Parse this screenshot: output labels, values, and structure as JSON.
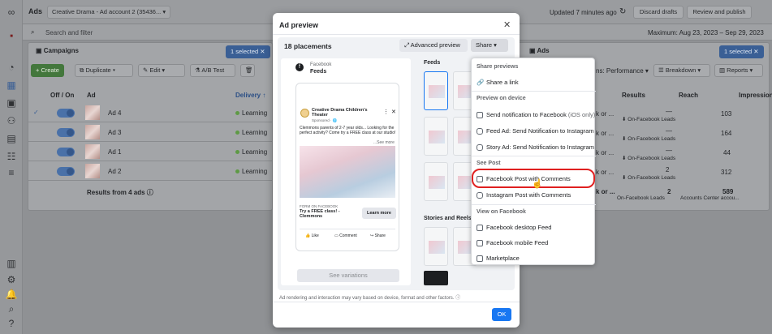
{
  "topbar": {
    "app": "Ads",
    "account": "Creative Drama - Ad account 2 (35436...",
    "updated": "Updated 7 minutes ago",
    "discard": "Discard drafts",
    "review": "Review and publish"
  },
  "searchbar": {
    "placeholder": "Search and filter",
    "date_range": "Maximum: Aug 23, 2023 – Sep 29, 2023"
  },
  "campaigns": {
    "tab": "Campaigns",
    "selected": "1 selected",
    "create": "+ Create",
    "duplicate": "Duplicate",
    "edit": "Edit",
    "abtest": "A/B Test"
  },
  "ads_tab": {
    "tab": "Ads",
    "selected": "1 selected",
    "columns": "ns: Performance",
    "breakdown": "Breakdown",
    "reports": "Reports"
  },
  "table": {
    "headers": {
      "onoff": "Off / On",
      "ad": "Ad",
      "delivery": "Delivery ↑",
      "results": "Results",
      "reach": "Reach",
      "impressions": "Impression"
    },
    "rows": [
      {
        "name": "Ad 4",
        "delivery": "Learning",
        "results": "—",
        "results_sub": "On-Facebook Leads",
        "reach": "103",
        "bid": "k or ..."
      },
      {
        "name": "Ad 3",
        "delivery": "Learning",
        "results": "—",
        "results_sub": "On-Facebook Leads",
        "reach": "164",
        "bid": "k or ..."
      },
      {
        "name": "Ad 1",
        "delivery": "Learning",
        "results": "—",
        "results_sub": "On-Facebook Leads",
        "reach": "44",
        "bid": "k or ..."
      },
      {
        "name": "Ad 2",
        "delivery": "Learning",
        "results": "2",
        "results_sub": "On-Facebook Leads",
        "reach": "312",
        "bid": "k or ..."
      }
    ],
    "summary": {
      "label": "Results from 4 ads",
      "results": "2",
      "results_sub": "On-Facebook Leads",
      "reach": "589",
      "reach_sub": "Accounts Center accou...",
      "bid": "k or ..."
    }
  },
  "modal": {
    "title": "Ad preview",
    "placements": "18 placements",
    "advanced": "Advanced preview",
    "share": "Share",
    "platform": "Facebook",
    "placement": "Feeds",
    "page_name": "Creative Drama Children's Theater",
    "sponsored": "Sponsored · 🌐",
    "body": "Clemmons parents of 2-7 year olds... Looking for the perfect activity? Come try a FREE class at our studio!",
    "see_more": "...See more",
    "form_label": "FORM ON FACEBOOK",
    "headline": "Try a FREE class! - Clemmons",
    "cta": "Learn more",
    "like": "Like",
    "comment": "Comment",
    "share_action": "Share",
    "see_variations": "See variations",
    "feeds_label": "Feeds",
    "stories_label": "Stories and Reels",
    "disclaimer": "Ad rendering and interaction may vary based on device, format and other factors.",
    "ok": "OK"
  },
  "share_menu": {
    "sec1": "Share previews",
    "share_link": "Share a link",
    "sec2": "Preview on device",
    "notif_fb": "Send notification to Facebook",
    "ios_only": "(iOS only)",
    "feed_ig": "Feed Ad: Send Notification to Instagram",
    "story_ig": "Story Ad: Send Notification to Instagram",
    "sec3": "See Post",
    "fb_post": "Facebook Post with Comments",
    "ig_post": "Instagram Post with Comments",
    "sec4": "View on Facebook",
    "desktop": "Facebook desktop Feed",
    "mobile": "Facebook mobile Feed",
    "market": "Marketplace"
  },
  "colors": {
    "highlight": "#e02020",
    "primary": "#1877f2"
  }
}
